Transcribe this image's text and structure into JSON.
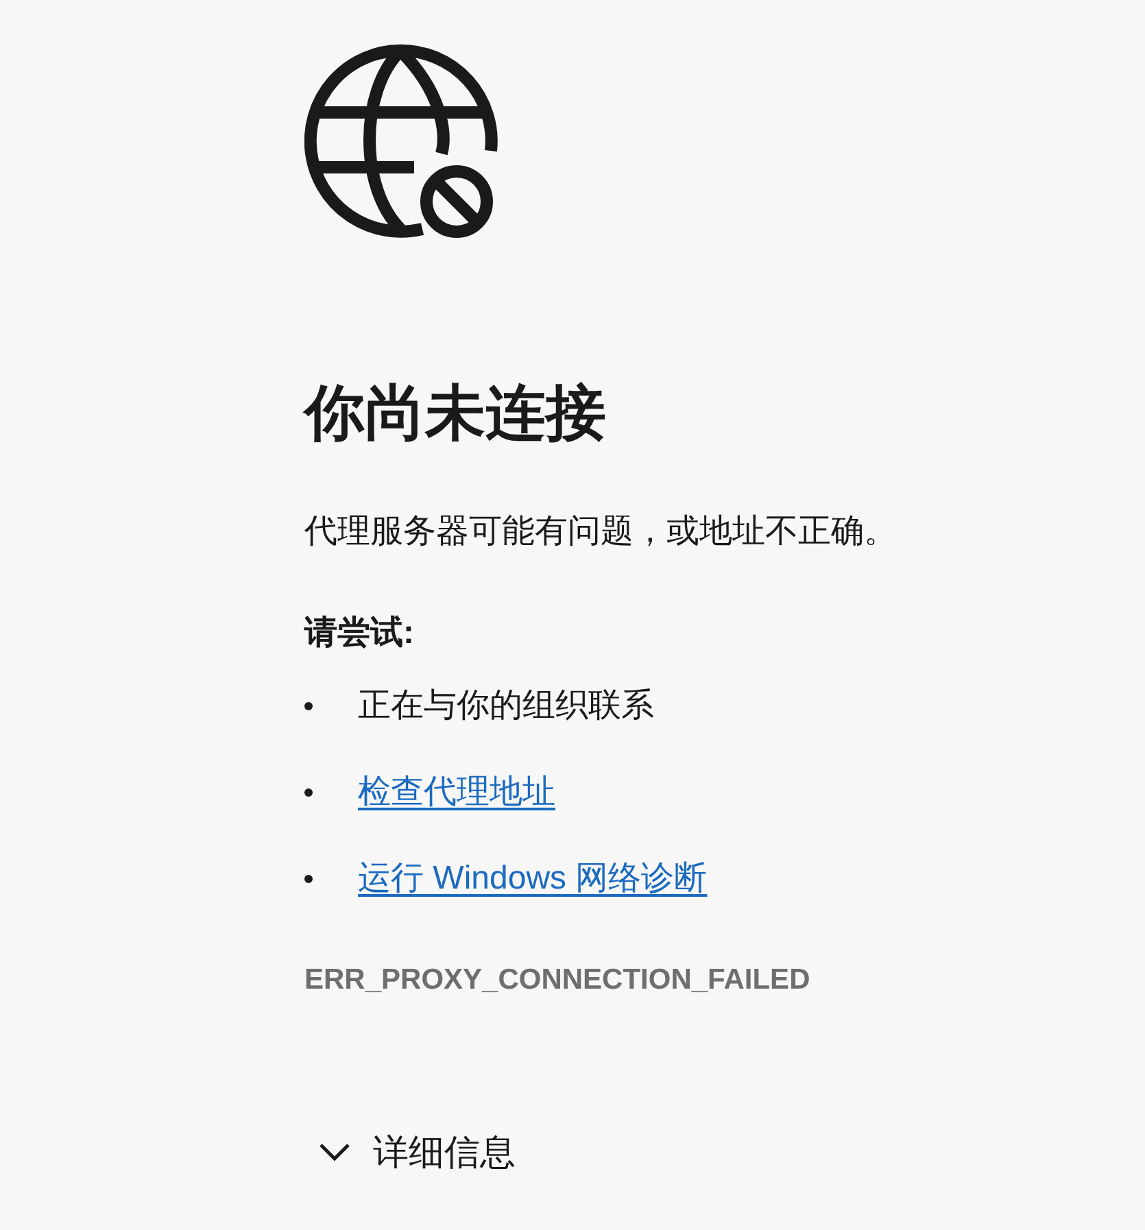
{
  "title": "你尚未连接",
  "message": "代理服务器可能有问题，或地址不正确。",
  "try_heading": "请尝试:",
  "suggestions": [
    {
      "kind": "text",
      "text": "正在与你的组织联系"
    },
    {
      "kind": "link",
      "text": "检查代理地址"
    },
    {
      "kind": "link",
      "text": "运行 Windows 网络诊断"
    }
  ],
  "error_code": "ERR_PROXY_CONNECTION_FAILED",
  "details": {
    "label": "详细信息",
    "expanded": false
  }
}
